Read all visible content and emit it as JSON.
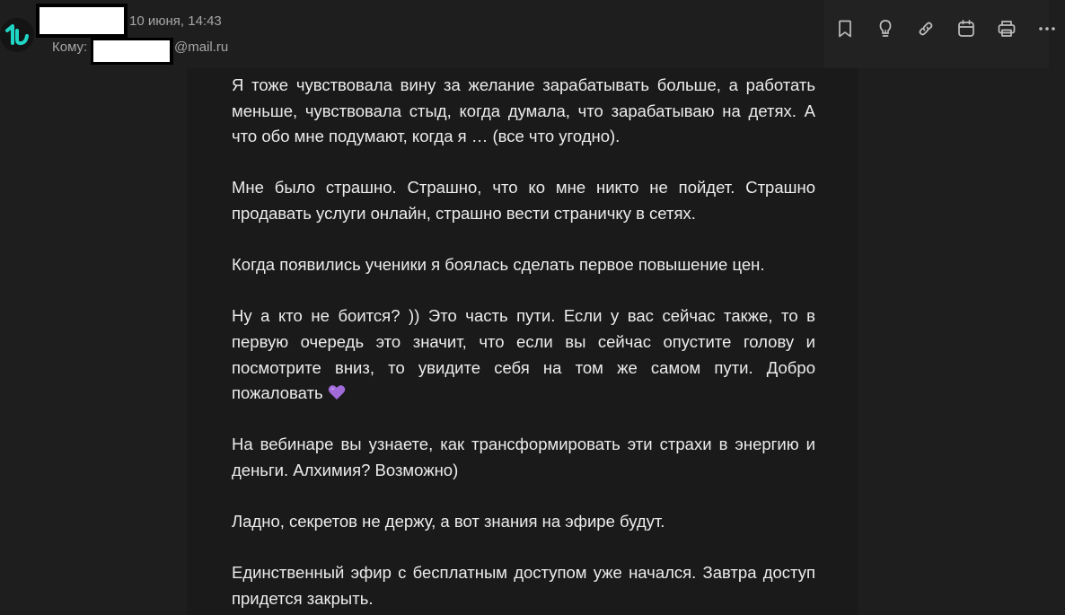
{
  "header": {
    "date": "10 июня, 14:43",
    "to_label": "Кому:",
    "to_domain": "@mail.ru"
  },
  "toolbar": {
    "icons": [
      "bookmark-icon",
      "lightbulb-icon",
      "link-icon",
      "calendar-icon",
      "print-icon",
      "more-icon"
    ]
  },
  "message": {
    "paragraphs": [
      "Я тоже чувствовала вину за желание зарабатывать больше, а работать меньше, чувствовала стыд, когда думала, что зарабатываю на детях. А что обо мне подумают, когда я … (все что угодно).",
      "Мне было страшно. Страшно, что ко мне никто не пойдет. Страшно продавать услуги онлайн, страшно вести страничку в сетях.",
      "Когда появились ученики я боялась сделать первое повышение цен.",
      "Ну а кто не боится? )) Это часть пути. Если у вас сейчас также, то в первую очередь это значит, что если вы сейчас опустите голову и посмотрите вниз, то увидите себя на том же самом пути. Добро пожаловать",
      "На вебинаре вы узнаете, как трансформировать эти страхи в энергию и деньги. Алхимия? Возможно)",
      "Ладно, секретов не держу, а вот знания на эфире будут.",
      "Единственный эфир с бесплатным доступом уже начался. Завтра доступ придется закрыть."
    ],
    "emoji": "purple-heart"
  },
  "colors": {
    "background": "#1e1e1e",
    "card": "#1a1a1a",
    "text": "#ececec",
    "muted": "#a6a6a6",
    "avatar_logo": "#1fd6c6",
    "heart": "#a06ad8"
  }
}
